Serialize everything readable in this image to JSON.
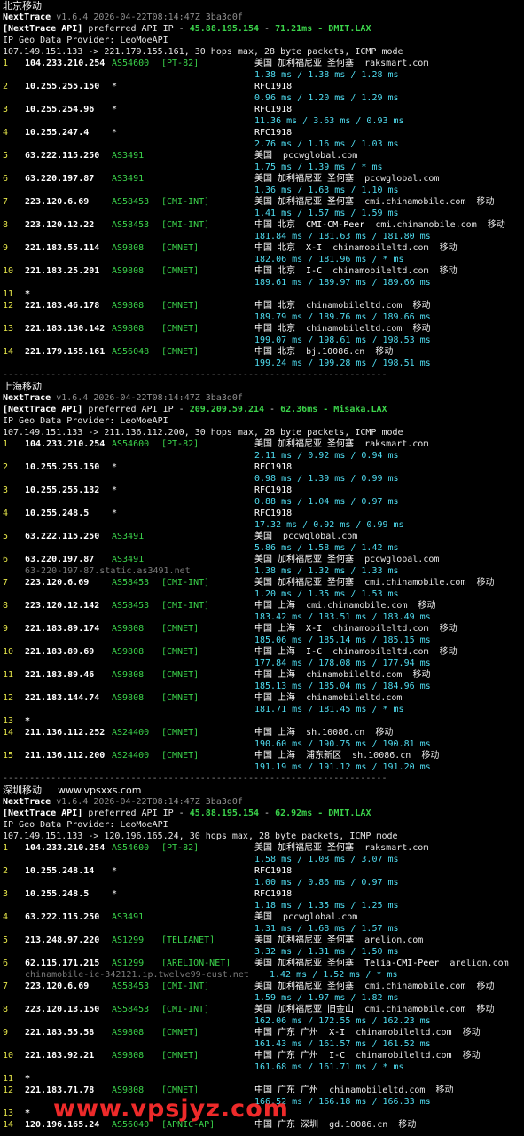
{
  "colors": {
    "background": "#000000",
    "asn": "#3bd44b",
    "latency": "#4fdcf0",
    "tag": "#3bd44b",
    "ip": "#ffffff",
    "watermark": "#ee2a2a"
  },
  "sections": [
    {
      "title": "北京移动",
      "title_extra": "",
      "nexttrace": "NextTrace",
      "version": "v1.6.4 2026-04-22T08:14:47Z 3ba3d0f",
      "api_prefix": "[NextTrace API]",
      "api_text": "preferred API IP - ",
      "api_ip": "45.88.195.154",
      "api_sep": " - ",
      "api_ms": "71.21ms",
      "api_loc": " - DMIT.LAX",
      "geo": "IP Geo Data Provider: LeoMoeAPI",
      "route": "107.149.151.133 -> 221.179.155.161, 30 hops max, 28 byte packets, ICMP mode",
      "hops": [
        {
          "n": "1",
          "ip": "104.233.210.254",
          "as": "AS54600",
          "tag": "[PT-82]",
          "geo": "美国 加利福尼亚 圣何塞",
          "host": "raksmart.com",
          "isp": "",
          "ms": "1.38 ms / 1.38 ms / 1.28 ms"
        },
        {
          "n": "2",
          "ip": "10.255.255.150",
          "as": "*",
          "tag": "",
          "geo": "RFC1918",
          "host": "",
          "isp": "",
          "ms": "0.96 ms / 1.20 ms / 1.29 ms"
        },
        {
          "n": "3",
          "ip": "10.255.254.96",
          "as": "*",
          "tag": "",
          "geo": "RFC1918",
          "host": "",
          "isp": "",
          "ms": "11.36 ms / 3.63 ms / 0.93 ms"
        },
        {
          "n": "4",
          "ip": "10.255.247.4",
          "as": "*",
          "tag": "",
          "geo": "RFC1918",
          "host": "",
          "isp": "",
          "ms": "2.76 ms / 1.16 ms / 1.03 ms"
        },
        {
          "n": "5",
          "ip": "63.222.115.250",
          "as": "AS3491",
          "tag": "",
          "geo": "美国",
          "host": "pccwglobal.com",
          "isp": "",
          "ms": "1.75 ms / 1.39 ms / * ms"
        },
        {
          "n": "6",
          "ip": "63.220.197.87",
          "as": "AS3491",
          "tag": "",
          "geo": "美国 加利福尼亚 圣何塞",
          "host": "pccwglobal.com",
          "isp": "",
          "ms": "1.36 ms / 1.63 ms / 1.10 ms"
        },
        {
          "n": "7",
          "ip": "223.120.6.69",
          "as": "AS58453",
          "tag": "[CMI-INT]",
          "geo": "美国 加利福尼亚 圣何塞",
          "host": "cmi.chinamobile.com",
          "isp": "移动",
          "ms": "1.41 ms / 1.57 ms / 1.59 ms"
        },
        {
          "n": "8",
          "ip": "223.120.12.22",
          "as": "AS58453",
          "tag": "[CMI-INT]",
          "geo": "中国 北京  CMI-CM-Peer",
          "host": "cmi.chinamobile.com",
          "isp": "移动",
          "ms": "181.84 ms / 181.63 ms / 181.80 ms"
        },
        {
          "n": "9",
          "ip": "221.183.55.114",
          "as": "AS9808",
          "tag": "[CMNET]",
          "geo": "中国 北京  X-I",
          "host": "chinamobileltd.com",
          "isp": "移动",
          "ms": "182.06 ms / 181.96 ms / * ms"
        },
        {
          "n": "10",
          "ip": "221.183.25.201",
          "as": "AS9808",
          "tag": "[CMNET]",
          "geo": "中国 北京  I-C",
          "host": "chinamobileltd.com",
          "isp": "移动",
          "ms": "189.61 ms / 189.97 ms / 189.66 ms"
        },
        {
          "n": "11",
          "ip": "*",
          "as": "",
          "tag": "",
          "geo": "",
          "host": "",
          "isp": "",
          "ms": ""
        },
        {
          "n": "12",
          "ip": "221.183.46.178",
          "as": "AS9808",
          "tag": "[CMNET]",
          "geo": "中国 北京",
          "host": "chinamobileltd.com",
          "isp": "移动",
          "ms": "189.79 ms / 189.76 ms / 189.66 ms"
        },
        {
          "n": "13",
          "ip": "221.183.130.142",
          "as": "AS9808",
          "tag": "[CMNET]",
          "geo": "中国 北京",
          "host": "chinamobileltd.com",
          "isp": "移动",
          "ms": "199.07 ms / 198.61 ms / 198.53 ms"
        },
        {
          "n": "14",
          "ip": "221.179.155.161",
          "as": "AS56048",
          "tag": "[CMNET]",
          "geo": "中国 北京",
          "host": "bj.10086.cn",
          "isp": "移动",
          "ms": "199.24 ms / 199.28 ms / 198.51 ms"
        }
      ]
    },
    {
      "title": "上海移动",
      "title_extra": "",
      "nexttrace": "NextTrace",
      "version": "v1.6.4 2026-04-22T08:14:47Z 3ba3d0f",
      "api_prefix": "[NextTrace API]",
      "api_text": "preferred API IP - ",
      "api_ip": "209.209.59.214",
      "api_sep": " - ",
      "api_ms": "62.36ms",
      "api_loc": " - Misaka.LAX",
      "geo": "IP Geo Data Provider: LeoMoeAPI",
      "route": "107.149.151.133 -> 211.136.112.200, 30 hops max, 28 byte packets, ICMP mode",
      "hops": [
        {
          "n": "1",
          "ip": "104.233.210.254",
          "as": "AS54600",
          "tag": "[PT-82]",
          "geo": "美国 加利福尼亚 圣何塞",
          "host": "raksmart.com",
          "isp": "",
          "ms": "2.11 ms / 0.92 ms / 0.94 ms"
        },
        {
          "n": "2",
          "ip": "10.255.255.150",
          "as": "*",
          "tag": "",
          "geo": "RFC1918",
          "host": "",
          "isp": "",
          "ms": "0.98 ms / 1.39 ms / 0.99 ms"
        },
        {
          "n": "3",
          "ip": "10.255.255.132",
          "as": "*",
          "tag": "",
          "geo": "RFC1918",
          "host": "",
          "isp": "",
          "ms": "0.88 ms / 1.04 ms / 0.97 ms"
        },
        {
          "n": "4",
          "ip": "10.255.248.5",
          "as": "*",
          "tag": "",
          "geo": "RFC1918",
          "host": "",
          "isp": "",
          "ms": "17.32 ms / 0.92 ms / 0.99 ms"
        },
        {
          "n": "5",
          "ip": "63.222.115.250",
          "as": "AS3491",
          "tag": "",
          "geo": "美国",
          "host": "pccwglobal.com",
          "isp": "",
          "ms": "5.86 ms / 1.58 ms / 1.42 ms"
        },
        {
          "n": "6",
          "ip": "63.220.197.87",
          "as": "AS3491",
          "tag": "",
          "geo": "美国 加利福尼亚 圣何塞",
          "host": "pccwglobal.com",
          "isp": "",
          "rdns": "63-220-197-87.static.as3491.net",
          "ms": "1.38 ms / 1.32 ms / 1.33 ms"
        },
        {
          "n": "7",
          "ip": "223.120.6.69",
          "as": "AS58453",
          "tag": "[CMI-INT]",
          "geo": "美国 加利福尼亚 圣何塞",
          "host": "cmi.chinamobile.com",
          "isp": "移动",
          "ms": "1.20 ms / 1.35 ms / 1.53 ms"
        },
        {
          "n": "8",
          "ip": "223.120.12.142",
          "as": "AS58453",
          "tag": "[CMI-INT]",
          "geo": "中国 上海",
          "host": "cmi.chinamobile.com",
          "isp": "移动",
          "ms": "183.42 ms / 183.51 ms / 183.49 ms"
        },
        {
          "n": "9",
          "ip": "221.183.89.174",
          "as": "AS9808",
          "tag": "[CMNET]",
          "geo": "中国 上海  X-I",
          "host": "chinamobileltd.com",
          "isp": "移动",
          "ms": "185.06 ms / 185.14 ms / 185.15 ms"
        },
        {
          "n": "10",
          "ip": "221.183.89.69",
          "as": "AS9808",
          "tag": "[CMNET]",
          "geo": "中国 上海  I-C",
          "host": "chinamobileltd.com",
          "isp": "移动",
          "ms": "177.84 ms / 178.08 ms / 177.94 ms"
        },
        {
          "n": "11",
          "ip": "221.183.89.46",
          "as": "AS9808",
          "tag": "[CMNET]",
          "geo": "中国 上海",
          "host": "chinamobileltd.com",
          "isp": "移动",
          "ms": "185.13 ms / 185.04 ms / 184.96 ms"
        },
        {
          "n": "12",
          "ip": "221.183.144.74",
          "as": "AS9808",
          "tag": "[CMNET]",
          "geo": "中国 上海",
          "host": "chinamobileltd.com",
          "isp": "",
          "ms": "181.71 ms / 181.45 ms / * ms"
        },
        {
          "n": "13",
          "ip": "*",
          "as": "",
          "tag": "",
          "geo": "",
          "host": "",
          "isp": "",
          "ms": ""
        },
        {
          "n": "14",
          "ip": "211.136.112.252",
          "as": "AS24400",
          "tag": "[CMNET]",
          "geo": "中国 上海",
          "host": "sh.10086.cn",
          "isp": "移动",
          "ms": "190.60 ms / 190.75 ms / 190.81 ms"
        },
        {
          "n": "15",
          "ip": "211.136.112.200",
          "as": "AS24400",
          "tag": "[CMNET]",
          "geo": "中国 上海  浦东新区",
          "host": "sh.10086.cn",
          "isp": "移动",
          "ms": "191.19 ms / 191.12 ms / 191.20 ms"
        }
      ]
    },
    {
      "title": "深圳移动",
      "title_extra": "www.vpsxxs.com",
      "nexttrace": "NextTrace",
      "version": "v1.6.4 2026-04-22T08:14:47Z 3ba3d0f",
      "api_prefix": "[NextTrace API]",
      "api_text": "preferred API IP - ",
      "api_ip": "45.88.195.154",
      "api_sep": " - ",
      "api_ms": "62.92ms",
      "api_loc": " - DMIT.LAX",
      "geo": "IP Geo Data Provider: LeoMoeAPI",
      "route": "107.149.151.133 -> 120.196.165.24, 30 hops max, 28 byte packets, ICMP mode",
      "hops": [
        {
          "n": "1",
          "ip": "104.233.210.254",
          "as": "AS54600",
          "tag": "[PT-82]",
          "geo": "美国 加利福尼亚 圣何塞",
          "host": "raksmart.com",
          "isp": "",
          "ms": "1.58 ms / 1.08 ms / 3.07 ms"
        },
        {
          "n": "2",
          "ip": "10.255.248.14",
          "as": "*",
          "tag": "",
          "geo": "RFC1918",
          "host": "",
          "isp": "",
          "ms": "1.00 ms / 0.86 ms / 0.97 ms"
        },
        {
          "n": "3",
          "ip": "10.255.248.5",
          "as": "*",
          "tag": "",
          "geo": "RFC1918",
          "host": "",
          "isp": "",
          "ms": "1.18 ms / 1.35 ms / 1.25 ms"
        },
        {
          "n": "4",
          "ip": "63.222.115.250",
          "as": "AS3491",
          "tag": "",
          "geo": "美国",
          "host": "pccwglobal.com",
          "isp": "",
          "ms": "1.31 ms / 1.68 ms / 1.57 ms"
        },
        {
          "n": "5",
          "ip": "213.248.97.220",
          "as": "AS1299",
          "tag": "[TELIANET]",
          "geo": "美国 加利福尼亚 圣何塞",
          "host": "arelion.com",
          "isp": "",
          "ms": "3.32 ms / 1.31 ms / 1.50 ms"
        },
        {
          "n": "6",
          "ip": "62.115.171.215",
          "as": "AS1299",
          "tag": "[ARELION-NET]",
          "geo": "美国 加利福尼亚 圣何塞  Telia-CMI-Peer",
          "host": "arelion.com",
          "isp": "",
          "rdns": "chinamobile-ic-342121.ip.twelve99-cust.net",
          "ms": "1.42 ms / 1.52 ms / * ms"
        },
        {
          "n": "7",
          "ip": "223.120.6.69",
          "as": "AS58453",
          "tag": "[CMI-INT]",
          "geo": "美国 加利福尼亚 圣何塞",
          "host": "cmi.chinamobile.com",
          "isp": "移动",
          "ms": "1.59 ms / 1.97 ms / 1.82 ms"
        },
        {
          "n": "8",
          "ip": "223.120.13.150",
          "as": "AS58453",
          "tag": "[CMI-INT]",
          "geo": "美国 加利福尼亚 旧金山",
          "host": "cmi.chinamobile.com",
          "isp": "移动",
          "ms": "162.06 ms / 172.55 ms / 162.23 ms"
        },
        {
          "n": "9",
          "ip": "221.183.55.58",
          "as": "AS9808",
          "tag": "[CMNET]",
          "geo": "中国 广东 广州  X-I",
          "host": "chinamobileltd.com",
          "isp": "移动",
          "ms": "161.43 ms / 161.57 ms / 161.52 ms"
        },
        {
          "n": "10",
          "ip": "221.183.92.21",
          "as": "AS9808",
          "tag": "[CMNET]",
          "geo": "中国 广东 广州  I-C",
          "host": "chinamobileltd.com",
          "isp": "移动",
          "ms": "161.68 ms / 161.71 ms / * ms"
        },
        {
          "n": "11",
          "ip": "*",
          "as": "",
          "tag": "",
          "geo": "",
          "host": "",
          "isp": "",
          "ms": ""
        },
        {
          "n": "12",
          "ip": "221.183.71.78",
          "as": "AS9808",
          "tag": "[CMNET]",
          "geo": "中国 广东 广州",
          "host": "chinamobileltd.com",
          "isp": "移动",
          "ms": "166.52 ms / 166.18 ms / 166.33 ms"
        },
        {
          "n": "13",
          "ip": "*",
          "as": "",
          "tag": "",
          "geo": "",
          "host": "",
          "isp": "",
          "ms": ""
        },
        {
          "n": "14",
          "ip": "120.196.165.24",
          "as": "AS56040",
          "tag": "[APNIC-AP]",
          "geo": "中国 广东 深圳",
          "host": "gd.10086.cn",
          "isp": "移动",
          "ms": ""
        }
      ]
    }
  ],
  "separator": "------------------------------------------------------------------------",
  "watermark": "www.vpsjyz.com"
}
